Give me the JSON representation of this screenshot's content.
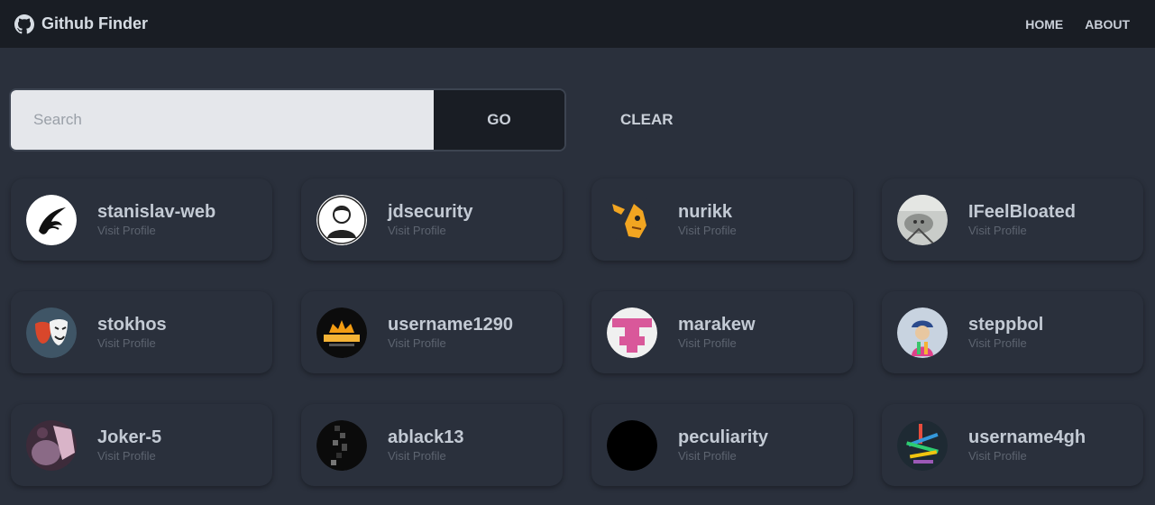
{
  "app": {
    "title": "Github Finder"
  },
  "nav": {
    "home_label": "HOME",
    "about_label": "ABOUT"
  },
  "search": {
    "placeholder": "Search",
    "go_label": "GO",
    "clear_label": "CLEAR"
  },
  "users": [
    {
      "login": "stanislav-web",
      "visit": "Visit Profile",
      "avatar": "dragon-icon"
    },
    {
      "login": "jdsecurity",
      "visit": "Visit Profile",
      "avatar": "person-icon"
    },
    {
      "login": "nurikk",
      "visit": "Visit Profile",
      "avatar": "cartoon-icon"
    },
    {
      "login": "IFeelBloated",
      "visit": "Visit Profile",
      "avatar": "cat-photo"
    },
    {
      "login": "stokhos",
      "visit": "Visit Profile",
      "avatar": "theater-masks-icon"
    },
    {
      "login": "username1290",
      "visit": "Visit Profile",
      "avatar": "halloween-icon"
    },
    {
      "login": "marakew",
      "visit": "Visit Profile",
      "avatar": "identicon"
    },
    {
      "login": "steppbol",
      "visit": "Visit Profile",
      "avatar": "colorful-figure"
    },
    {
      "login": "Joker-5",
      "visit": "Visit Profile",
      "avatar": "photo"
    },
    {
      "login": "ablack13",
      "visit": "Visit Profile",
      "avatar": "dark-pixel-icon"
    },
    {
      "login": "peculiarity",
      "visit": "Visit Profile",
      "avatar": "black-circle"
    },
    {
      "login": "username4gh",
      "visit": "Visit Profile",
      "avatar": "crayons-photo"
    }
  ]
}
